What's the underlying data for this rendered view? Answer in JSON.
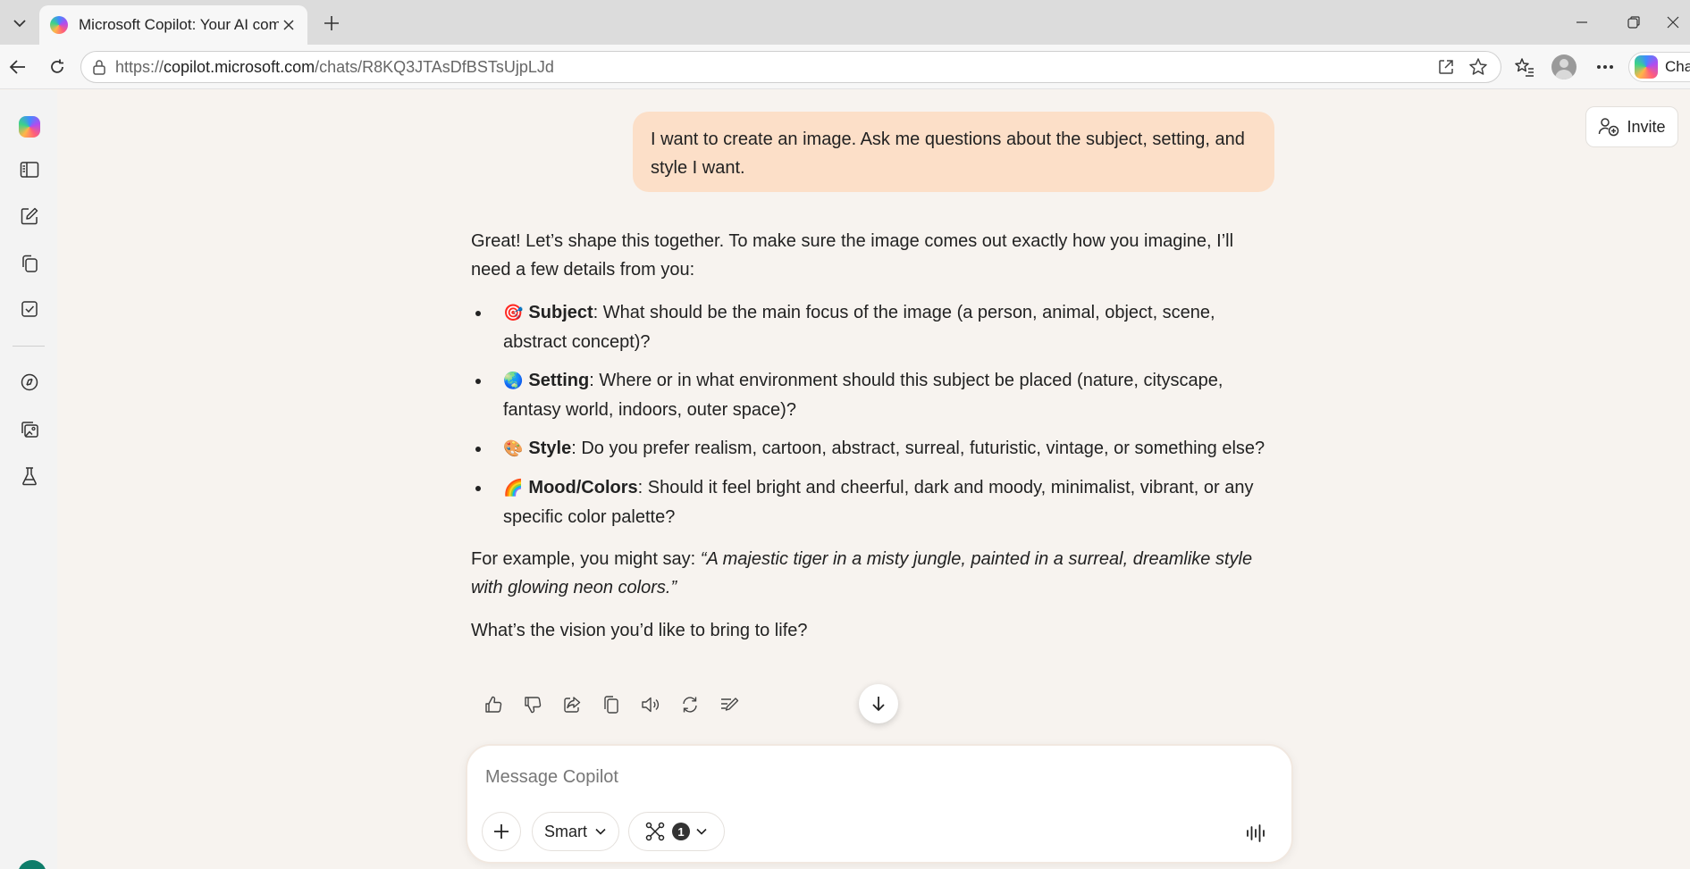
{
  "browser": {
    "tab_title": "Microsoft Copilot: Your AI companion",
    "url_scheme": "https://",
    "url_host": "copilot.microsoft.com",
    "url_path": "/chats/R8KQ3JTAsDfBSTsUjpLJd",
    "copilot_chip_label": "Cha"
  },
  "header": {
    "invite_label": "Invite"
  },
  "conversation": {
    "user_message": "I want to create an image. Ask me questions about the subject, setting, and style I want.",
    "reply_intro": "Great! Let’s shape this together. To make sure the image comes out exactly how you imagine, I’ll need a few details from you:",
    "questions": [
      {
        "emoji": "🎯",
        "emoji_icon": "target-icon",
        "title": "Subject",
        "text": ": What should be the main focus of the image (a person, animal, object, scene, abstract concept)?"
      },
      {
        "emoji": "🌏",
        "emoji_icon": "globe-icon",
        "title": "Setting",
        "text": ": Where or in what environment should this subject be placed (nature, cityscape, fantasy world, indoors, outer space)?"
      },
      {
        "emoji": "🎨",
        "emoji_icon": "palette-icon",
        "title": "Style",
        "text": ": Do you prefer realism, cartoon, abstract, surreal, futuristic, vintage, or something else?"
      },
      {
        "emoji": "🌈",
        "emoji_icon": "rainbow-icon",
        "title": "Mood/Colors",
        "text": ": Should it feel bright and cheerful, dark and moody, minimalist, vibrant, or any specific color palette?"
      }
    ],
    "example_prefix": "For example, you might say: ",
    "example_text": "“A majestic tiger in a misty jungle, painted in a surreal, dreamlike style with glowing neon colors.”",
    "closing": "What’s the vision you’d like to bring to life?"
  },
  "composer": {
    "placeholder": "Message Copilot",
    "mode_label": "Smart",
    "tools_count": "1"
  },
  "colors": {
    "page_background": "#f7f3ef",
    "user_bubble": "#fcdfc8",
    "user_avatar": "#0e7d6a"
  }
}
